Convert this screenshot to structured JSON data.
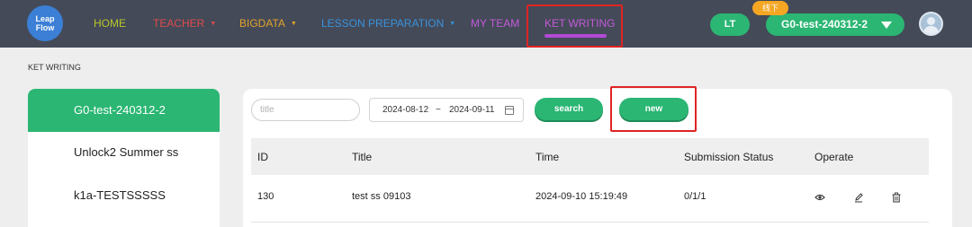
{
  "brand": {
    "logo_line1": "Leap",
    "logo_line2": "Flow"
  },
  "nav": {
    "home": "HOME",
    "teacher": "TEACHER",
    "bigdata": "BIGDATA",
    "lesson_preparation": "LESSON PREPARATION",
    "my_team": "MY TEAM",
    "ket_writing": "KET WRITING",
    "colors": {
      "home": "#b7c72a",
      "teacher": "#e04b4b",
      "bigdata": "#e3a22a",
      "lesson_preparation": "#3a93dd",
      "my_team": "#c25ad8",
      "ket_writing": "#c25ad8"
    }
  },
  "header_right": {
    "lt_button": "LT",
    "offline_badge": "线下",
    "class_select": "G0-test-240312-2"
  },
  "breadcrumb": "KET WRITING",
  "sidebar": {
    "items": [
      {
        "label": "G0-test-240312-2",
        "active": true
      },
      {
        "label": "Unlock2 Summer ss",
        "active": false
      },
      {
        "label": "k1a-TESTSSSSS",
        "active": false
      }
    ]
  },
  "filters": {
    "title_placeholder": "title",
    "date_start": "2024-08-12",
    "date_separator": "~",
    "date_end": "2024-09-11",
    "search_label": "search",
    "new_label": "new"
  },
  "table": {
    "headers": [
      "ID",
      "Title",
      "Time",
      "Submission Status",
      "Operate"
    ],
    "rows": [
      {
        "id": "130",
        "title": "test ss 09103",
        "time": "2024-09-10 15:19:49",
        "status": "0/1/1"
      }
    ]
  },
  "icons": [
    "view-icon",
    "edit-icon",
    "delete-icon",
    "calendar-icon",
    "chevron-down-icon",
    "user-avatar-icon"
  ],
  "accent_color": "#2bb673"
}
